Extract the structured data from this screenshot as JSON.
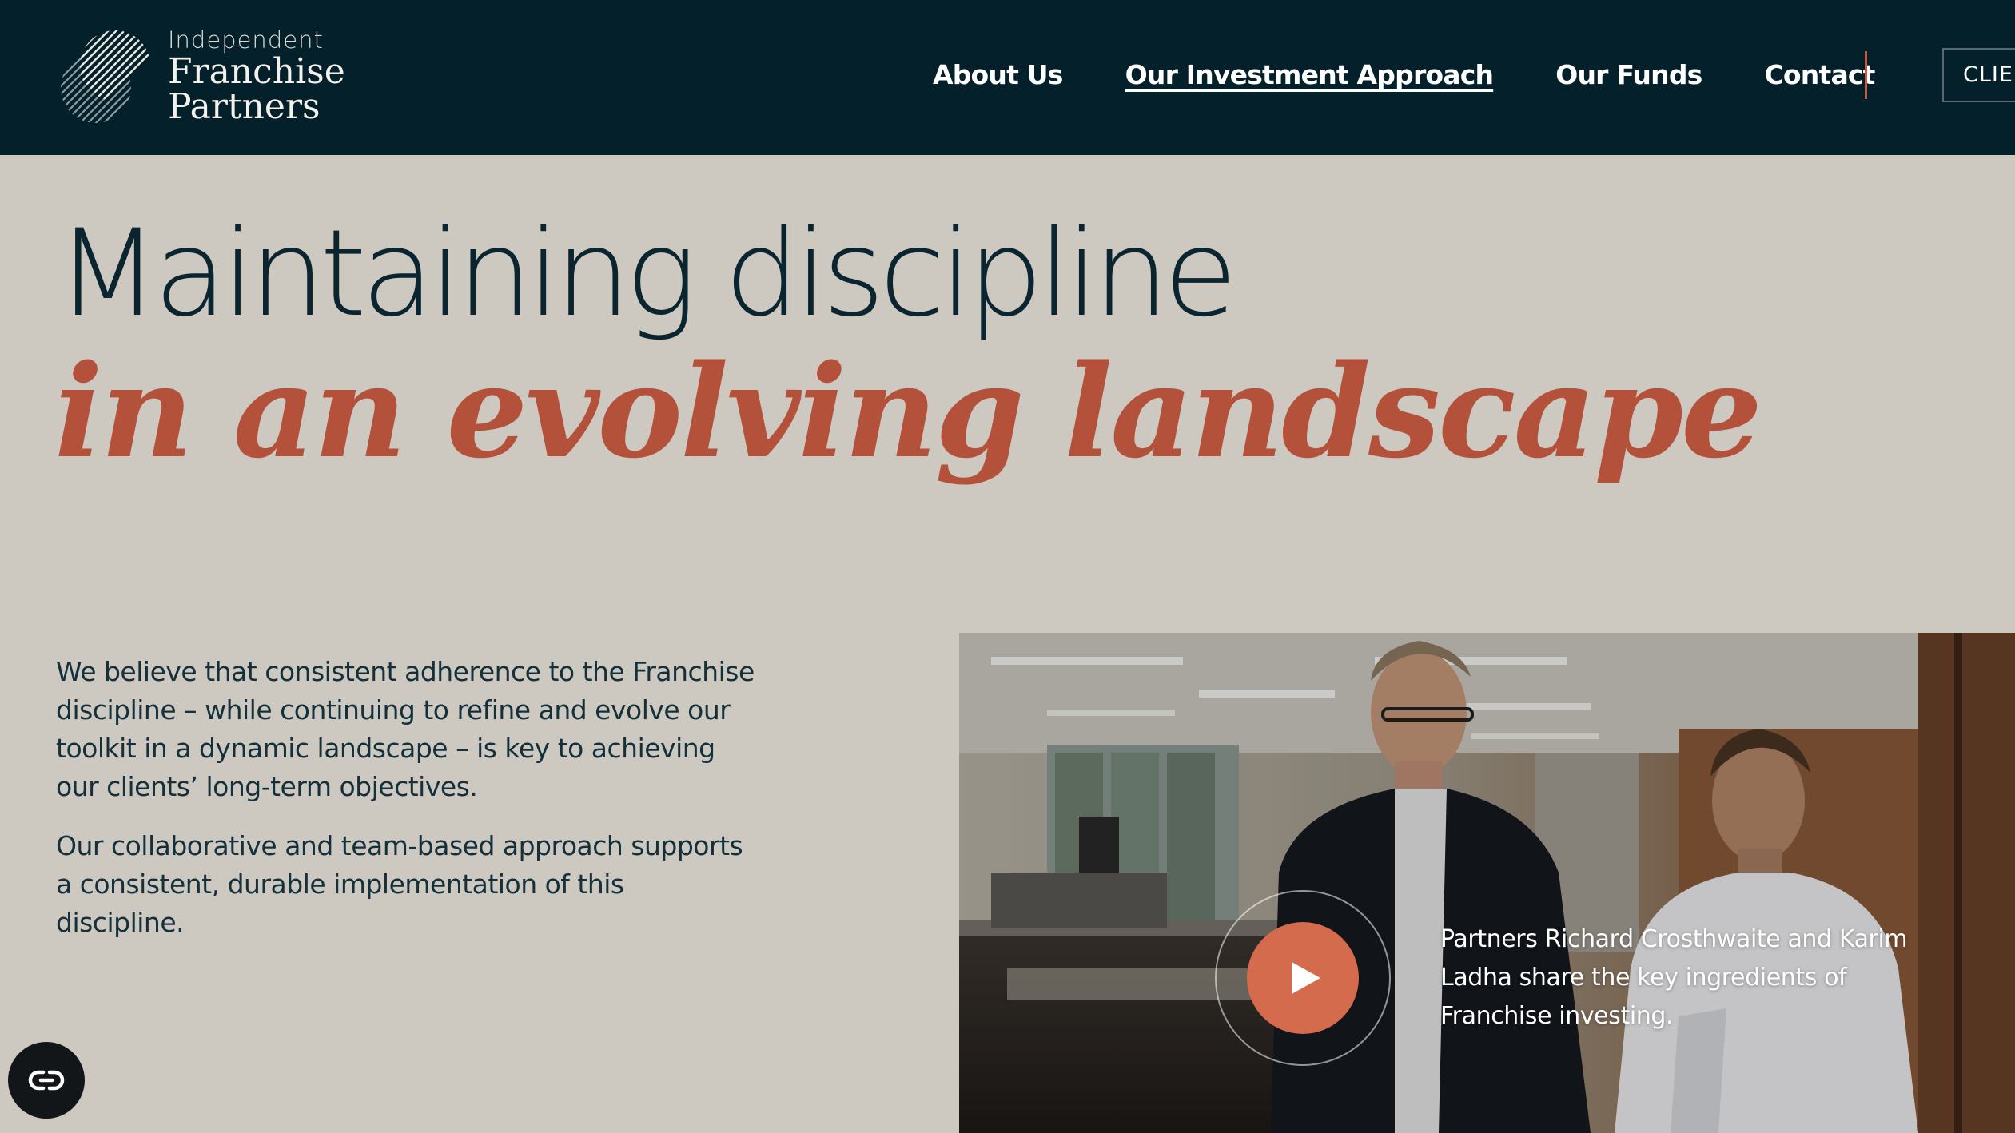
{
  "header": {
    "logo": {
      "small": "Independent",
      "line1": "Franchise",
      "line2": "Partners"
    },
    "nav": [
      {
        "label": "About Us",
        "active": false
      },
      {
        "label": "Our Investment Approach",
        "active": true
      },
      {
        "label": "Our Funds",
        "active": false
      },
      {
        "label": "Contact",
        "active": false
      }
    ],
    "client_button": "CLIEN"
  },
  "hero": {
    "line1": "Maintaining discipline",
    "line2": "in an evolving landscape"
  },
  "body": {
    "paragraph1": "We believe that consistent adherence to the Franchise discipline – while continuing to refine and evolve our toolkit in a dynamic landscape – is key to achieving our clients’ long-term objectives.",
    "paragraph2": "Our collaborative and team-based approach supports a consistent, durable implementation of this discipline."
  },
  "video": {
    "caption": "Partners Richard Crosthwaite and Karim Ladha share the key ingredients of Franchise investing.",
    "play_icon": "play-icon"
  },
  "accessibility": {
    "icon": "accessibility-icon"
  },
  "colors": {
    "header_bg": "#03202b",
    "page_bg": "#cdc8c0",
    "accent": "#b4513a",
    "play_button": "#d46b4c",
    "text_dark": "#0b2530"
  }
}
